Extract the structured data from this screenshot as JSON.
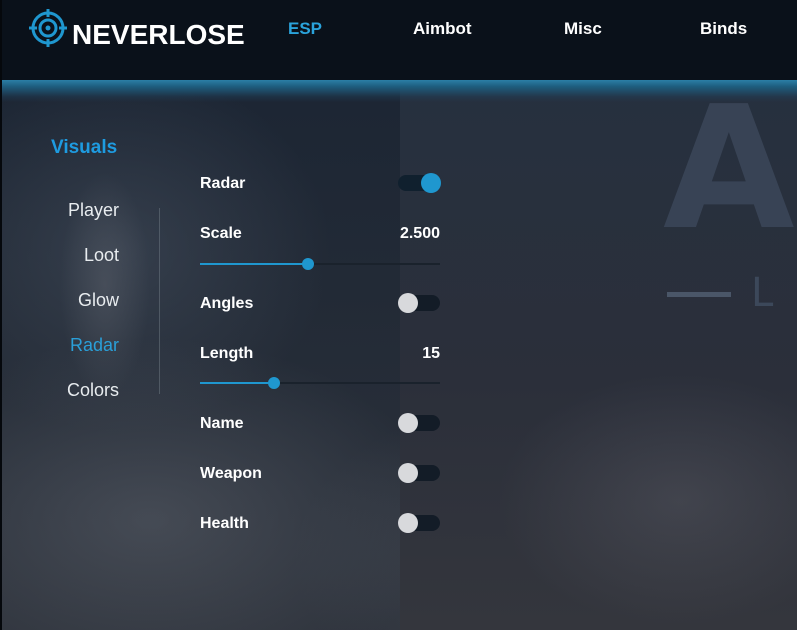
{
  "app": {
    "brand": "NEVERLOSE",
    "accent": "#1f97cf"
  },
  "nav": {
    "items": [
      {
        "label": "ESP",
        "active": true
      },
      {
        "label": "Aimbot",
        "active": false
      },
      {
        "label": "Misc",
        "active": false
      },
      {
        "label": "Binds",
        "active": false
      }
    ]
  },
  "sidebar": {
    "title": "Visuals",
    "items": [
      {
        "label": "Player",
        "active": false
      },
      {
        "label": "Loot",
        "active": false
      },
      {
        "label": "Glow",
        "active": false
      },
      {
        "label": "Radar",
        "active": true
      },
      {
        "label": "Colors",
        "active": false
      }
    ]
  },
  "settings": {
    "radar": {
      "label": "Radar",
      "enabled": true
    },
    "scale": {
      "label": "Scale",
      "value": "2.500",
      "fill_fraction": 0.45
    },
    "angles": {
      "label": "Angles",
      "enabled": false
    },
    "length": {
      "label": "Length",
      "value": "15",
      "fill_fraction": 0.31
    },
    "name": {
      "label": "Name",
      "enabled": false
    },
    "weapon": {
      "label": "Weapon",
      "enabled": false
    },
    "health": {
      "label": "Health",
      "enabled": false
    }
  }
}
